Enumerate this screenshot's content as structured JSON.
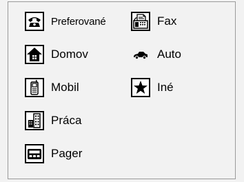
{
  "items": [
    {
      "id": "preferred",
      "label": "Preferované",
      "icon": "telephone-icon"
    },
    {
      "id": "home",
      "label": "Domov",
      "icon": "house-icon"
    },
    {
      "id": "mobile",
      "label": "Mobil",
      "icon": "mobile-phone-icon"
    },
    {
      "id": "work",
      "label": "Práca",
      "icon": "office-building-icon"
    },
    {
      "id": "pager",
      "label": "Pager",
      "icon": "pager-icon"
    },
    {
      "id": "fax",
      "label": "Fax",
      "icon": "fax-machine-icon"
    },
    {
      "id": "car",
      "label": "Auto",
      "icon": "car-icon"
    },
    {
      "id": "other",
      "label": "Iné",
      "icon": "star-icon"
    }
  ]
}
